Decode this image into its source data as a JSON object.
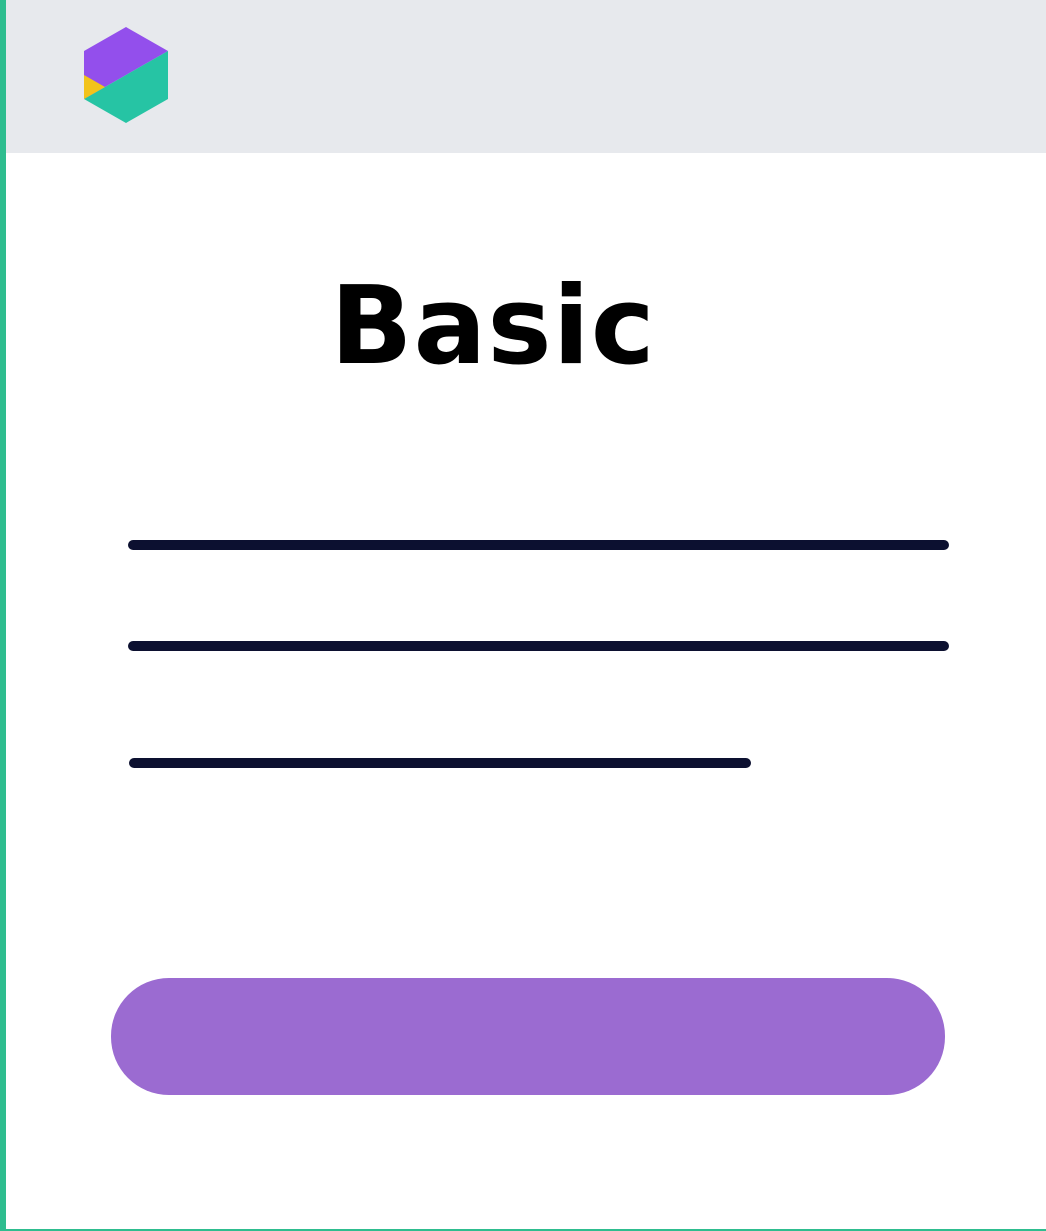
{
  "plan": {
    "title": "Basic",
    "cta_label": ""
  },
  "brand": {
    "logo_icon": "hexagon-logo-icon",
    "colors": {
      "accent_green": "#2ebd8f",
      "logo_purple": "#934fec",
      "logo_teal": "#26c4a4",
      "logo_yellow": "#f2c31b",
      "button_purple": "#9b6bd1",
      "header_gray": "#e7e9ed",
      "line_navy": "#0c1030"
    }
  },
  "features": {
    "count_lines": 3
  }
}
